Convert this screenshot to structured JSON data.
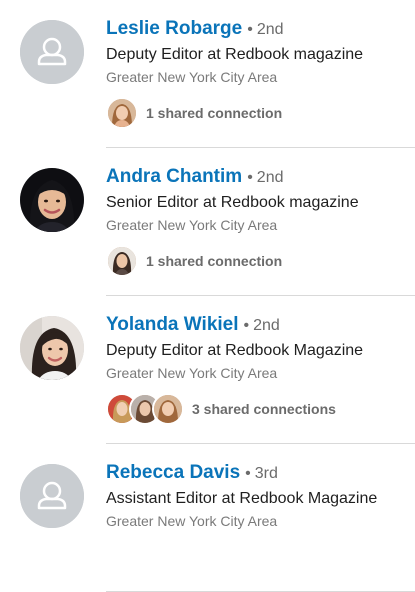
{
  "people": [
    {
      "name": "Leslie Robarge",
      "degree": "2nd",
      "headline": "Deputy Editor at Redbook magazine",
      "location": "Greater New York City Area",
      "avatar": "placeholder-person-icon",
      "shared": "1 shared connection",
      "shared_faces": [
        "face-1"
      ]
    },
    {
      "name": "Andra Chantim",
      "degree": "2nd",
      "headline": "Senior Editor at Redbook magazine",
      "location": "Greater New York City Area",
      "avatar": "photo",
      "shared": "1 shared connection",
      "shared_faces": [
        "face-2"
      ]
    },
    {
      "name": "Yolanda Wikiel",
      "degree": "2nd",
      "headline": "Deputy Editor at Redbook Magazine",
      "location": "Greater New York City Area",
      "avatar": "photo",
      "shared": "3 shared connections",
      "shared_faces": [
        "face-3",
        "face-4",
        "face-5"
      ]
    },
    {
      "name": "Rebecca Davis",
      "degree": "3rd",
      "headline": "Assistant Editor at Redbook Magazine",
      "location": "Greater New York City Area",
      "avatar": "placeholder-person-icon",
      "shared": "",
      "shared_faces": []
    }
  ],
  "colors": {
    "name_link": "#0a74b9",
    "divider": "#d9d9d9",
    "placeholder_bg": "#c9cdd1"
  }
}
